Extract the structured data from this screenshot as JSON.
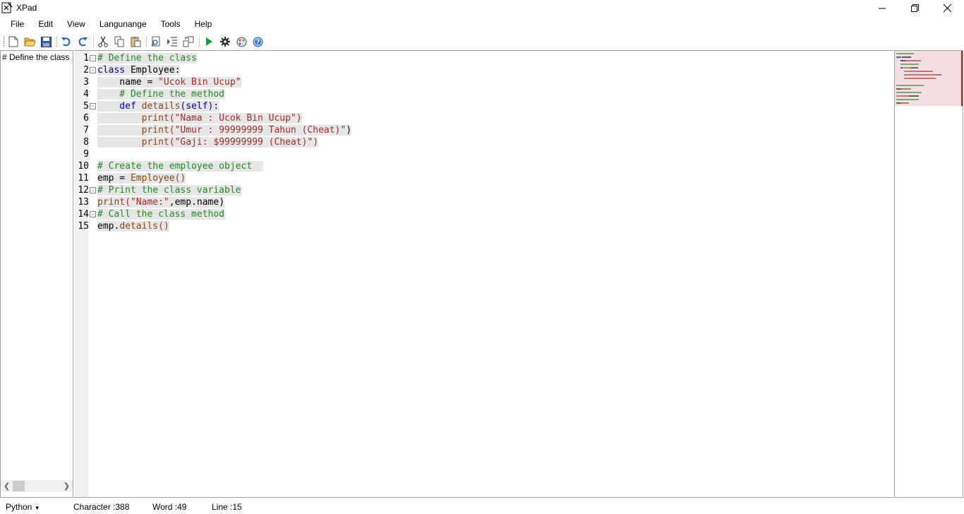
{
  "window": {
    "title": "XPad"
  },
  "menu": [
    "File",
    "Edit",
    "View",
    "Langunange",
    "Tools",
    "Help"
  ],
  "toolbar": {
    "icons": [
      "new-file-icon",
      "open-folder-icon",
      "save-icon",
      "undo-icon",
      "redo-icon",
      "cut-icon",
      "copy-icon",
      "paste-icon",
      "find-icon",
      "indent-icon",
      "replace-icon",
      "run-icon",
      "settings-icon",
      "theme-icon",
      "help-icon"
    ]
  },
  "left_panel": {
    "text": "# Define the class"
  },
  "editor": {
    "line_numbers": [
      "1",
      "2",
      "3",
      "4",
      "5",
      "6",
      "7",
      "8",
      "9",
      "10",
      "11",
      "12",
      "13",
      "14",
      "15"
    ],
    "lines": [
      [
        [
          "c-com",
          "# Define the class"
        ]
      ],
      [
        [
          "c-kw",
          "class"
        ],
        [
          "c-id",
          " Employee:"
        ]
      ],
      [
        [
          "c-id",
          "    name = "
        ],
        [
          "c-str",
          "\"Ucok Bin Ucup\""
        ]
      ],
      [
        [
          "c-com",
          "    # Define the method"
        ]
      ],
      [
        [
          "c-def",
          "    def"
        ],
        [
          "c-fn",
          " details"
        ],
        [
          "c-kw",
          "(self)"
        ],
        [
          "c-id",
          ":"
        ]
      ],
      [
        [
          "c-fn",
          "        print"
        ],
        [
          "c-str",
          "(\"Nama : Ucok Bin Ucup\")"
        ]
      ],
      [
        [
          "c-fn",
          "        print"
        ],
        [
          "c-str",
          "(\"Umur : 99999999 Tahun (Cheat)\""
        ],
        [
          "c-id",
          ")"
        ]
      ],
      [
        [
          "c-fn",
          "        print"
        ],
        [
          "c-str",
          "(\"Gaji: $99999999 (Cheat)\")"
        ]
      ],
      [],
      [
        [
          "c-com",
          "# Create the employee object  "
        ]
      ],
      [
        [
          "c-id",
          "emp = "
        ],
        [
          "c-fn",
          "Employee()"
        ]
      ],
      [
        [
          "c-com",
          "# Print the class variable"
        ]
      ],
      [
        [
          "c-fn",
          "print"
        ],
        [
          "c-str",
          "(\"Name:\""
        ],
        [
          "c-id",
          ",emp.name)"
        ]
      ],
      [
        [
          "c-com",
          "# Call the class method"
        ]
      ],
      [
        [
          "c-id",
          "emp."
        ],
        [
          "c-fn",
          "details()"
        ]
      ]
    ],
    "fold_lines": [
      1,
      2,
      5,
      12,
      14
    ]
  },
  "statusbar": {
    "language": "Python",
    "character": "Character :388",
    "word": "Word :49",
    "line": "Line :15"
  },
  "colors": {
    "minimap_view": "#f3dfe1",
    "minimap_border": "#b22222",
    "highlight": "#e6e6e6"
  }
}
